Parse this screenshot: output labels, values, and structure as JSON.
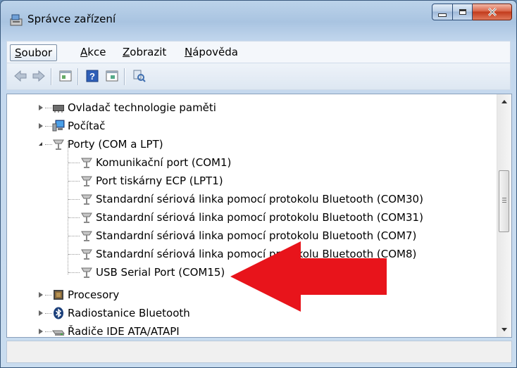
{
  "window": {
    "title": "Správce zařízení"
  },
  "menu": {
    "items": [
      {
        "key": "S",
        "rest": "oubor",
        "active": true
      },
      {
        "key": "A",
        "rest": "kce",
        "active": false
      },
      {
        "key": "Z",
        "rest": "obrazit",
        "active": false
      },
      {
        "key": "N",
        "rest": "ápověda",
        "active": false
      }
    ]
  },
  "toolbar": {
    "icons": [
      "back-arrow-icon",
      "forward-arrow-icon",
      "properties-icon",
      "help-icon",
      "update-driver-icon",
      "scan-hardware-icon"
    ]
  },
  "tree": {
    "rows": [
      {
        "label": "Ovladač technologie paměti",
        "state": "collapsed",
        "icon": "memory-controller-icon"
      },
      {
        "label": "Počítač",
        "state": "collapsed",
        "icon": "computer-icon"
      },
      {
        "label": "Porty (COM a LPT)",
        "state": "expanded",
        "icon": "port-icon"
      },
      {
        "label": "Komunikační port (COM1)",
        "state": "child",
        "icon": "port-icon"
      },
      {
        "label": "Port tiskárny ECP (LPT1)",
        "state": "child",
        "icon": "port-icon"
      },
      {
        "label": "Standardní sériová linka pomocí protokolu Bluetooth (COM30)",
        "state": "child",
        "icon": "port-icon"
      },
      {
        "label": "Standardní sériová linka pomocí protokolu Bluetooth (COM31)",
        "state": "child",
        "icon": "port-icon"
      },
      {
        "label": "Standardní sériová linka pomocí protokolu Bluetooth (COM7)",
        "state": "child",
        "icon": "port-icon"
      },
      {
        "label": "Standardní sériová linka pomocí protokolu Bluetooth (COM8)",
        "state": "child",
        "icon": "port-icon"
      },
      {
        "label": "USB Serial Port (COM15)",
        "state": "child",
        "icon": "port-icon"
      },
      {
        "label": "Procesory",
        "state": "collapsed",
        "icon": "processor-icon"
      },
      {
        "label": "Radiostanice Bluetooth",
        "state": "collapsed",
        "icon": "bluetooth-icon"
      },
      {
        "label": "Řadiče IDE ATA/ATAPI",
        "state": "collapsed",
        "icon": "ide-controller-icon"
      }
    ]
  },
  "annotation": {
    "arrow_color": "#e8141b",
    "points_to": "USB Serial Port (COM15)"
  },
  "colors": {
    "title_bar": "#a9c4e1",
    "close_button": "#c23b1c",
    "tree_background": "#ffffff"
  }
}
